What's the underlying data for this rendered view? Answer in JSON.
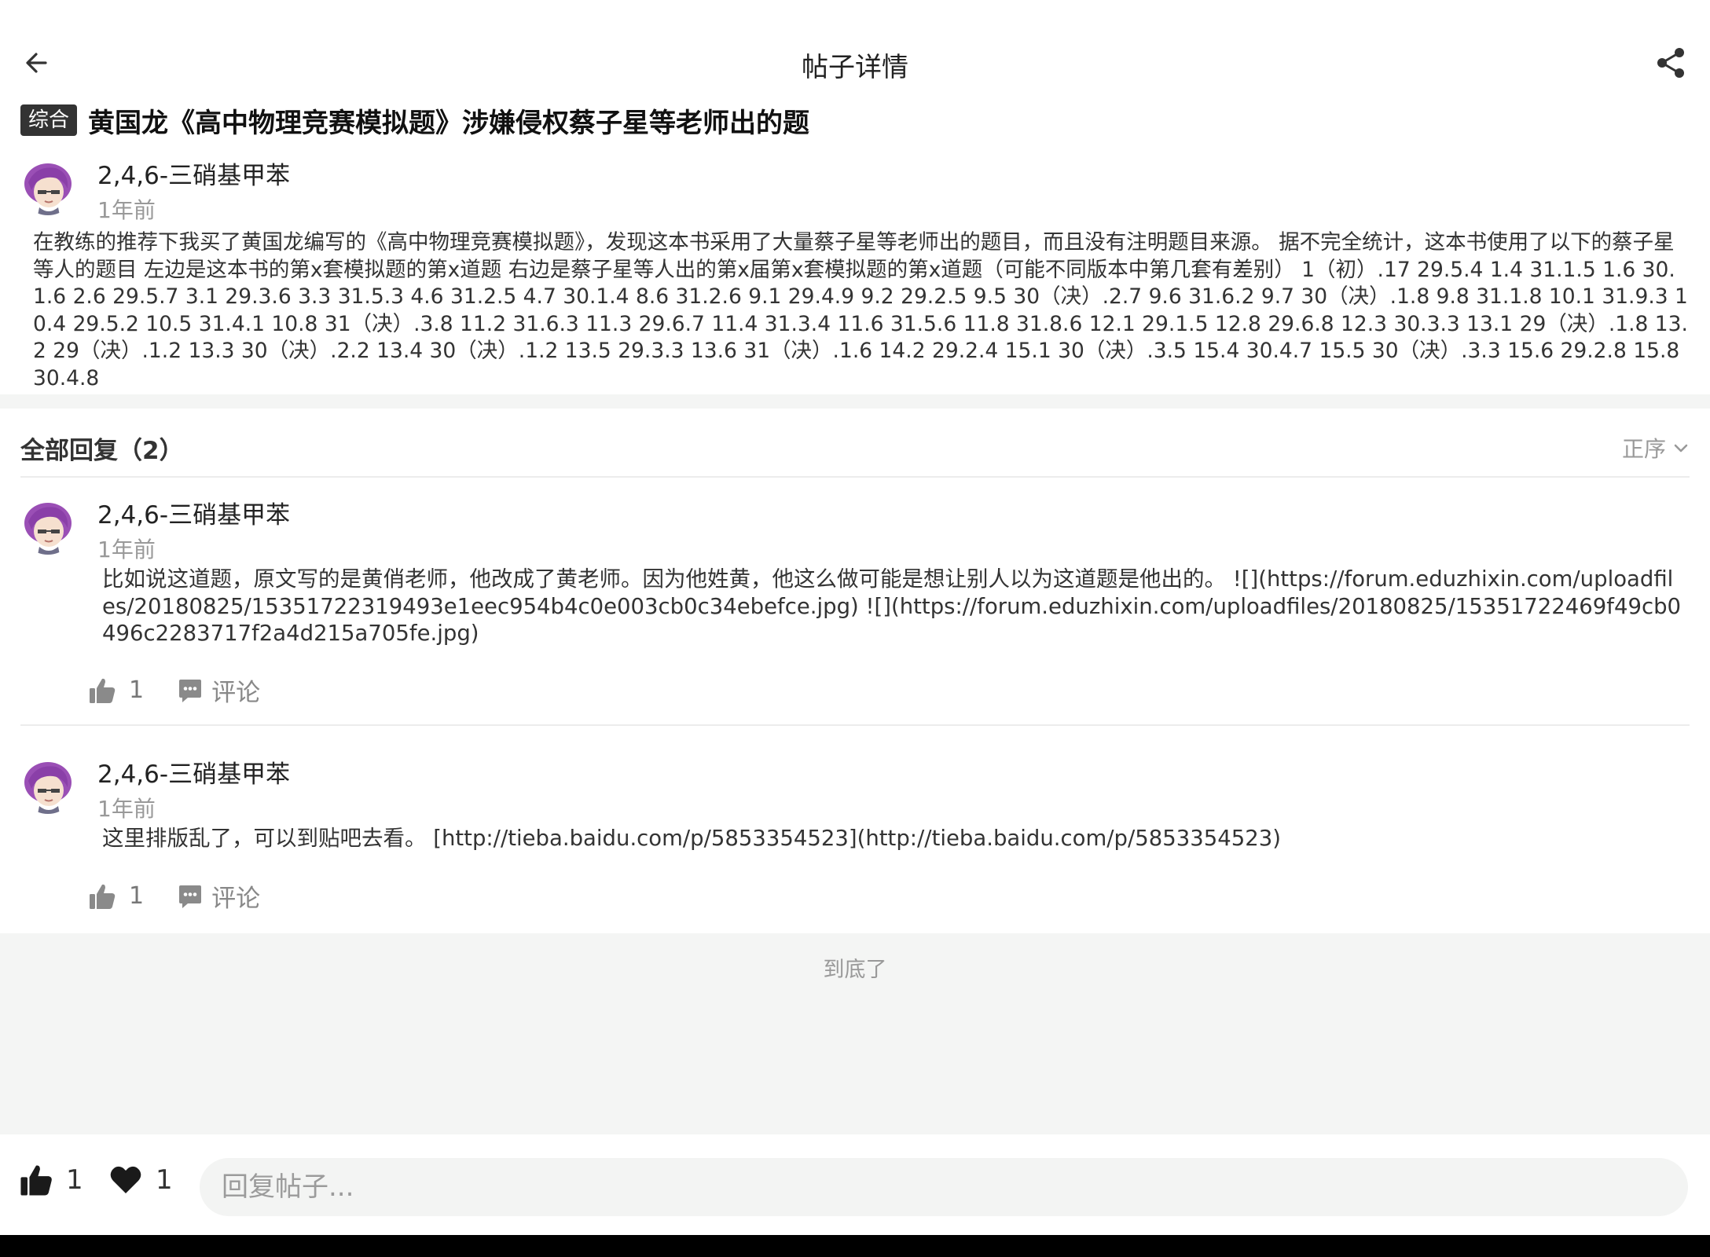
{
  "header": {
    "title": "帖子详情",
    "back_icon": "arrow-left-icon",
    "share_icon": "share-icon"
  },
  "post": {
    "tag": "综合",
    "title": "黄国龙《高中物理竞赛模拟题》涉嫌侵权蔡子星等老师出的题",
    "author": "2,4,6-三硝基甲苯",
    "time": "1年前",
    "body": "在教练的推荐下我买了黄国龙编写的《高中物理竞赛模拟题》，发现这本书采用了大量蔡子星等老师出的题目，而且没有注明题目来源。 据不完全统计，这本书使用了以下的蔡子星等人的题目 左边是这本书的第x套模拟题的第x道题 右边是蔡子星等人出的第x届第x套模拟题的第x道题（可能不同版本中第几套有差别） 1（初）.17 29.5.4 1.4 31.1.5 1.6 30.1.6 2.6 29.5.7 3.1 29.3.6 3.3 31.5.3 4.6 31.2.5 4.7 30.1.4 8.6 31.2.6 9.1 29.4.9 9.2 29.2.5 9.5 30（决）.2.7 9.6 31.6.2 9.7 30（决）.1.8 9.8 31.1.8 10.1 31.9.3 10.4 29.5.2 10.5 31.4.1 10.8 31（决）.3.8 11.2 31.6.3 11.3 29.6.7 11.4 31.3.4 11.6 31.5.6 11.8 31.8.6 12.1 29.1.5 12.8 29.6.8 12.3 30.3.3 13.1 29（决）.1.8 13.2 29（决）.1.2 13.3 30（决）.2.2 13.4 30（决）.1.2 13.5 29.3.3 13.6 31（决）.1.6 14.2 29.2.4 15.1 30（决）.3.5 15.4 30.4.7 15.5 30（决）.3.3 15.6 29.2.8 15.8 30.4.8"
  },
  "replies_section": {
    "label": "全部回复（2）",
    "sort_label": "正序"
  },
  "replies": [
    {
      "author": "2,4,6-三硝基甲苯",
      "time": "1年前",
      "body": "比如说这道题，原文写的是黄俏老师，他改成了黄老师。因为他姓黄，他这么做可能是想让别人以为这道题是他出的。 ![](https://forum.eduzhixin.com/uploadfiles/20180825/15351722319493e1eec954b4c0e003cb0c34ebefce.jpg) ![](https://forum.eduzhixin.com/uploadfiles/20180825/15351722469f49cb0496c2283717f2a4d215a705fe.jpg)",
      "likes": "1",
      "comment_label": "评论"
    },
    {
      "author": "2,4,6-三硝基甲苯",
      "time": "1年前",
      "body": "这里排版乱了，可以到贴吧去看。 [http://tieba.baidu.com/p/5853354523](http://tieba.baidu.com/p/5853354523)",
      "likes": "1",
      "comment_label": "评论"
    }
  ],
  "end_text": "到底了",
  "footer": {
    "likes": "1",
    "favorites": "1",
    "reply_placeholder": "回复帖子..."
  }
}
